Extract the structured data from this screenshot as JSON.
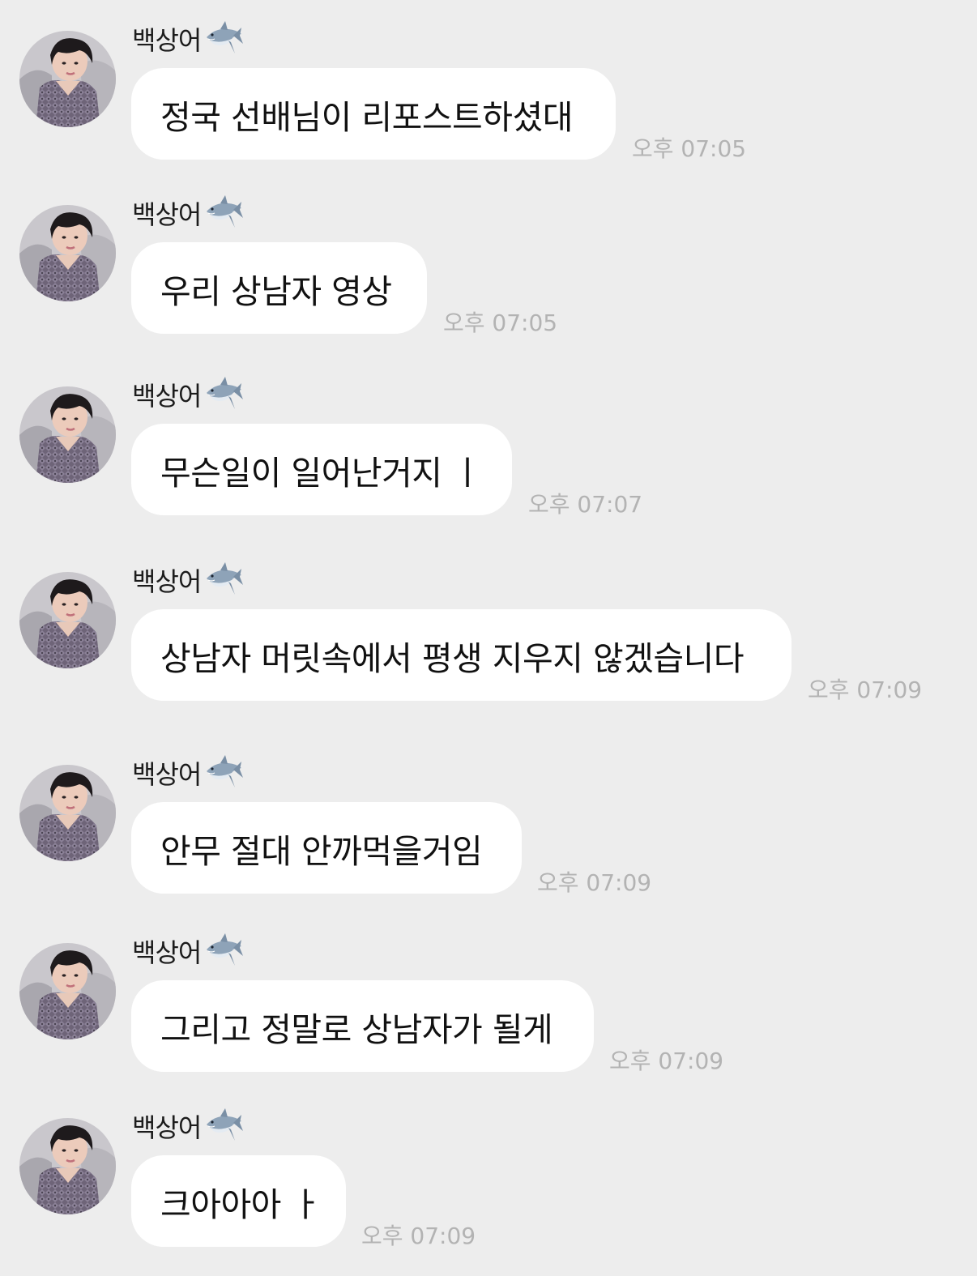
{
  "chat": {
    "sender_name": "백상어",
    "sender_emoji_icon": "shark-icon",
    "avatar": "profile-photo",
    "colors": {
      "background": "#ededed",
      "bubble": "#ffffff",
      "timestamp": "#b3b3b3"
    },
    "messages": [
      {
        "text": "정국 선배님이 리포스트하셨대",
        "time": "오후 07:05"
      },
      {
        "text": "우리 상남자 영상",
        "time": "오후 07:05"
      },
      {
        "text": "무슨일이 일어난거지 ㅣ",
        "time": "오후 07:07"
      },
      {
        "text": "상남자 머릿속에서 평생 지우지 않겠습니다",
        "time": "오후 07:09"
      },
      {
        "text": "안무 절대 안까먹을거임",
        "time": "오후 07:09"
      },
      {
        "text": "그리고 정말로 상남자가 될게",
        "time": "오후 07:09"
      },
      {
        "text": "크아아아 ㅏ",
        "time": "오후 07:09"
      }
    ]
  }
}
